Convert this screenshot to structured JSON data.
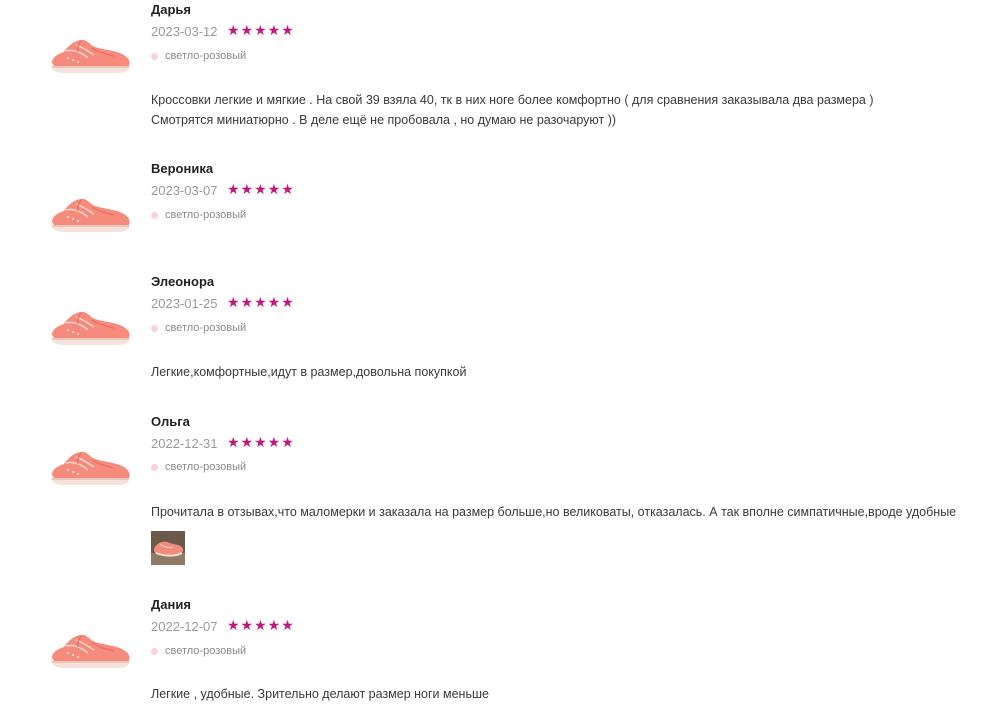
{
  "colors": {
    "star": "#c2187c",
    "swatch_light_pink": "#f9d3dc"
  },
  "reviews": [
    {
      "author": "Дарья",
      "date": "2023-03-12",
      "stars": "★★★★★",
      "rating": 5,
      "color_label": "светло-розовый",
      "text_lines": [
        "Кроссовки легкие и мягкие . На свой 39 взяла 40, тк в них ноге более комфортно ( для сравнения заказывала два размера )",
        "Смотрятся миниатюрно . В деле ещё не пробовала , но думаю не разочаруют ))"
      ]
    },
    {
      "author": "Вероника",
      "date": "2023-03-07",
      "stars": "★★★★★",
      "rating": 5,
      "color_label": "светло-розовый",
      "text_lines": []
    },
    {
      "author": "Элеонора",
      "date": "2023-01-25",
      "stars": "★★★★★",
      "rating": 5,
      "color_label": "светло-розовый",
      "text_lines": [
        "Легкие,комфортные,идут в размер,довольна покупкой"
      ]
    },
    {
      "author": "Ольга",
      "date": "2022-12-31",
      "stars": "★★★★★",
      "rating": 5,
      "color_label": "светло-розовый",
      "text_lines": [
        "Прочитала в отзывах,что маломерки и заказала на размер больше,но великоваты, отказалась. А так вполне симпатичные,вроде удобные"
      ],
      "has_photo": true
    },
    {
      "author": "Дания",
      "date": "2022-12-07",
      "stars": "★★★★★",
      "rating": 5,
      "color_label": "светло-розовый",
      "text_lines": [
        "Легкие , удобные. Зрительно делают размер ноги меньше"
      ]
    }
  ]
}
